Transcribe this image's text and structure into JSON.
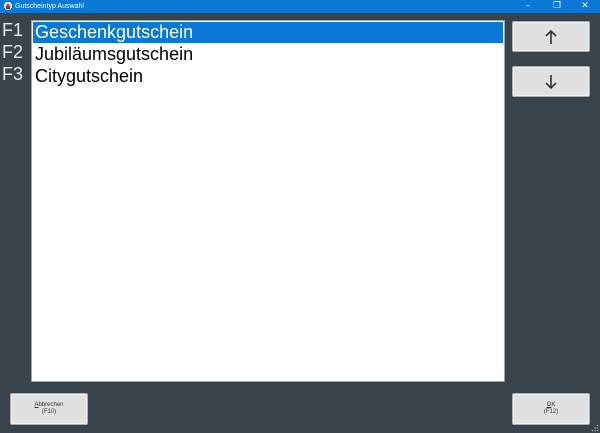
{
  "window": {
    "title": "Gutscheintyp Auswahl",
    "controls": {
      "minimize": "–",
      "maximize": "❐",
      "close": "✕"
    },
    "accent_color": "#0a78d7",
    "background_color": "#39434b"
  },
  "list": {
    "items": [
      {
        "key": "F1",
        "label": "Geschenkgutschein",
        "selected": true
      },
      {
        "key": "F2",
        "label": "Jubiläumsgutschein",
        "selected": false
      },
      {
        "key": "F3",
        "label": "Citygutschein",
        "selected": false
      }
    ]
  },
  "navigation": {
    "up_icon": "arrow-up-icon",
    "down_icon": "arrow-down-icon"
  },
  "buttons": {
    "cancel": {
      "accel": "A",
      "label_rest": "bbrechen",
      "key": "(F10)"
    },
    "ok": {
      "accel": "O",
      "label_rest": "K",
      "key": "(F12)"
    }
  }
}
